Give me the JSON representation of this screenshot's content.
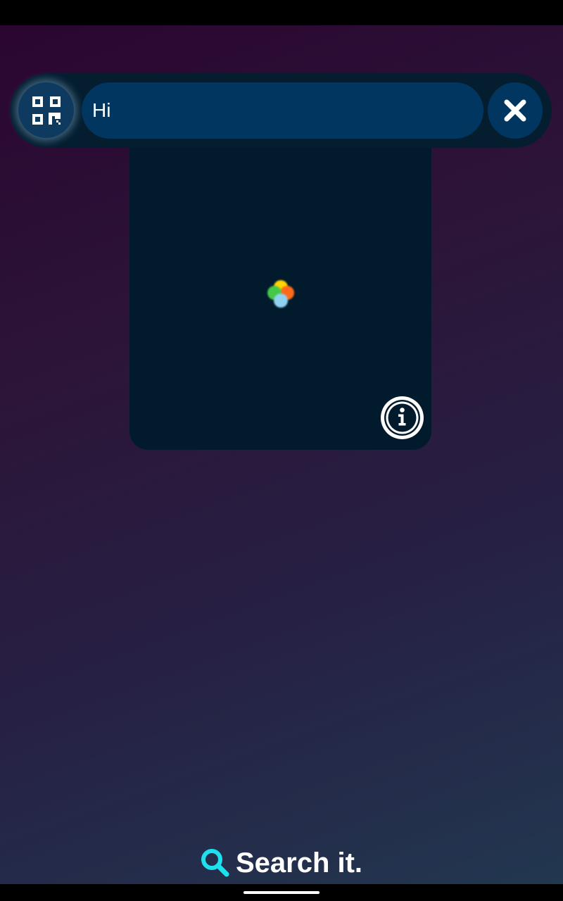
{
  "search": {
    "value": "Hi",
    "placeholder": ""
  },
  "icons": {
    "qr": "qr-code-icon",
    "close": "close-icon",
    "info": "info-icon",
    "search": "search-icon",
    "loader": "loading-dots-icon"
  },
  "loader_colors": [
    "#ffd400",
    "#ff6a1a",
    "#45c84a",
    "#8fd2f0"
  ],
  "tagline": {
    "text": "Search it."
  },
  "colors": {
    "accent": "#1ee0ec",
    "input_bg": "#013660",
    "panel_bg": "#021b2c"
  }
}
